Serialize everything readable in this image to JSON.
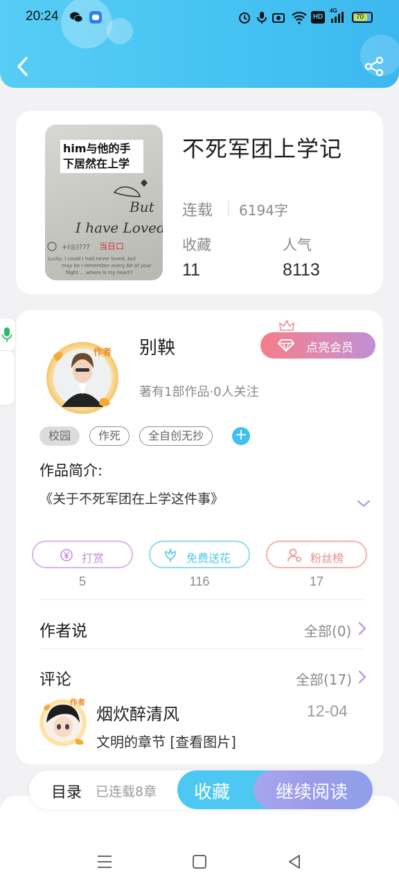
{
  "status_bar": {
    "time": "20:24",
    "battery": "70",
    "network": "4G",
    "hd": "HD"
  },
  "header": {
    "back_icon": "chevron-left-icon",
    "share_icon": "share-icon",
    "accent_color": "#4cc7f3"
  },
  "book": {
    "cover_text": "him与他的手下居然在上学",
    "title": "不死军团上学记",
    "status": "连载",
    "word_count": "6194字",
    "stats": [
      {
        "label": "收藏",
        "value": "11"
      },
      {
        "label": "人气",
        "value": "8113"
      }
    ]
  },
  "author": {
    "badge": "作者",
    "name": "别鞅",
    "meta": "著有1部作品·0人关注",
    "vip_button": "点亮会员"
  },
  "tags": [
    "校园",
    "作死",
    "全自创无抄"
  ],
  "intro": {
    "label": "作品简介:",
    "text": "《关于不死军团在上学这件事》"
  },
  "actions": [
    {
      "label": "打赏",
      "count": "5",
      "icon": "yen-icon",
      "color": "#c48be3"
    },
    {
      "label": "免费送花",
      "count": "116",
      "icon": "flower-icon",
      "color": "#4cc8e8"
    },
    {
      "label": "粉丝榜",
      "count": "17",
      "icon": "user-rank-icon",
      "color": "#f08a8a"
    }
  ],
  "author_says": {
    "title": "作者说",
    "link": "全部(0)"
  },
  "comments": {
    "title": "评论",
    "link": "全部(17)",
    "items": [
      {
        "user": "烟炊醉清风",
        "date": "12-04",
        "text": "文明的章节 [查看图片]",
        "badge": "作者"
      }
    ]
  },
  "bottom_bar": {
    "toc_label": "目录",
    "toc_count": "已连载8章",
    "collect_label": "收藏",
    "read_label": "继续阅读"
  }
}
